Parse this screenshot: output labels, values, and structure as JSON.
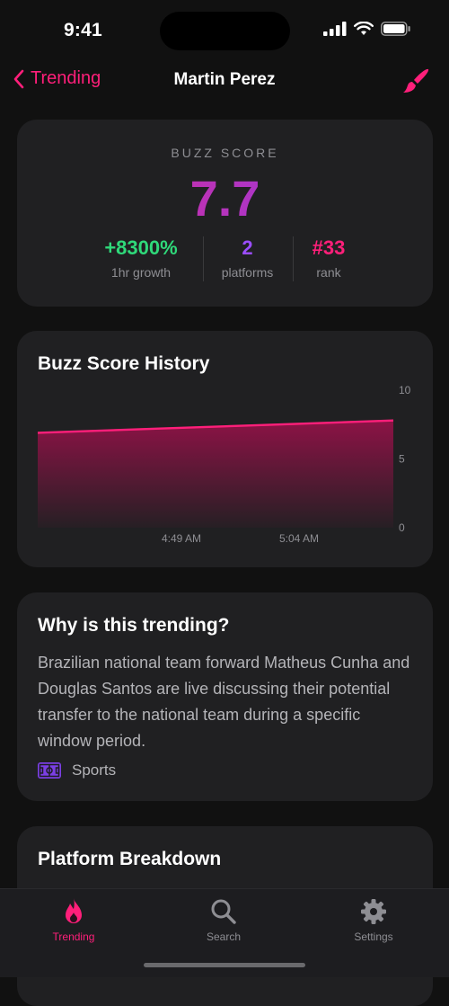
{
  "status": {
    "time": "9:41"
  },
  "nav": {
    "back_label": "Trending",
    "title": "Martin Perez"
  },
  "buzz": {
    "label": "BUZZ SCORE",
    "score": "7.7",
    "stats": [
      {
        "value": "+8300%",
        "label": "1hr growth",
        "color": "#2fd97a"
      },
      {
        "value": "2",
        "label": "platforms",
        "color": "#9b4dff"
      },
      {
        "value": "#33",
        "label": "rank",
        "color": "#ff1f7a"
      }
    ]
  },
  "history": {
    "title": "Buzz Score History",
    "chart_data": {
      "type": "area",
      "x_ticks": [
        "4:49 AM",
        "5:04 AM"
      ],
      "y_ticks": [
        "10",
        "5",
        "0"
      ],
      "ylim": [
        0,
        10
      ],
      "series": [
        {
          "values": [
            6.9,
            7.2,
            7.5,
            7.8
          ]
        }
      ],
      "color": "#ff1f7a"
    }
  },
  "why": {
    "title": "Why is this trending?",
    "text": "Brazilian national team forward Matheus Cunha and Douglas Santos are live discussing their potential transfer to the national team during a specific window period.",
    "category": "Sports",
    "category_icon": "soccer-field-icon"
  },
  "platform": {
    "title": "Platform Breakdown"
  },
  "tabs": [
    {
      "label": "Trending",
      "icon": "flame-icon",
      "active": true
    },
    {
      "label": "Search",
      "icon": "search-icon",
      "active": false
    },
    {
      "label": "Settings",
      "icon": "gear-icon",
      "active": false
    }
  ],
  "colors": {
    "accent": "#ff1f7a",
    "card": "#202022",
    "background": "#111111"
  }
}
